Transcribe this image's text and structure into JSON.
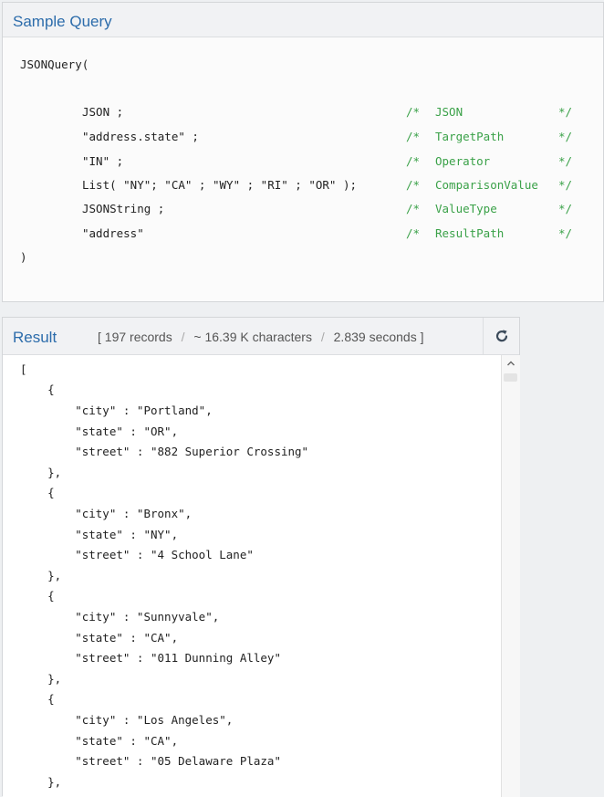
{
  "sample_query": {
    "title": "Sample Query",
    "open": "JSONQuery(",
    "close": ")",
    "args": [
      {
        "value": "JSON ;",
        "comment_open": "/*",
        "comment": "JSON",
        "comment_close": "*/"
      },
      {
        "value": "\"address.state\" ;",
        "comment_open": "/*",
        "comment": "TargetPath",
        "comment_close": "*/"
      },
      {
        "value": "\"IN\" ;",
        "comment_open": "/*",
        "comment": "Operator",
        "comment_close": "*/"
      },
      {
        "value": "List( \"NY\"; \"CA\" ; \"WY\" ; \"RI\" ; \"OR\" );",
        "comment_open": "/*",
        "comment": "ComparisonValue",
        "comment_close": "*/"
      },
      {
        "value": "JSONString ;",
        "comment_open": "/*",
        "comment": "ValueType",
        "comment_close": "*/"
      },
      {
        "value": "\"address\"",
        "comment_open": "/*",
        "comment": "ResultPath",
        "comment_close": "*/"
      }
    ]
  },
  "result": {
    "title": "Result",
    "stats": {
      "open": "[",
      "records": "197 records",
      "sep": "/",
      "characters": "~ 16.39 K characters",
      "seconds": "2.839 seconds",
      "close": "]"
    },
    "icons": {
      "refresh": "refresh-icon",
      "scroll_up": "chevron-up-icon"
    },
    "lines": [
      "[",
      "    {",
      "        \"city\" : \"Portland\",",
      "        \"state\" : \"OR\",",
      "        \"street\" : \"882 Superior Crossing\"",
      "    },",
      "    {",
      "        \"city\" : \"Bronx\",",
      "        \"state\" : \"NY\",",
      "        \"street\" : \"4 School Lane\"",
      "    },",
      "    {",
      "        \"city\" : \"Sunnyvale\",",
      "        \"state\" : \"CA\",",
      "        \"street\" : \"011 Dunning Alley\"",
      "    },",
      "    {",
      "        \"city\" : \"Los Angeles\",",
      "        \"state\" : \"CA\",",
      "        \"street\" : \"05 Delaware Plaza\"",
      "    },"
    ]
  },
  "colors": {
    "title": "#2c6cab",
    "comment": "#3aa148",
    "text": "#222222"
  }
}
